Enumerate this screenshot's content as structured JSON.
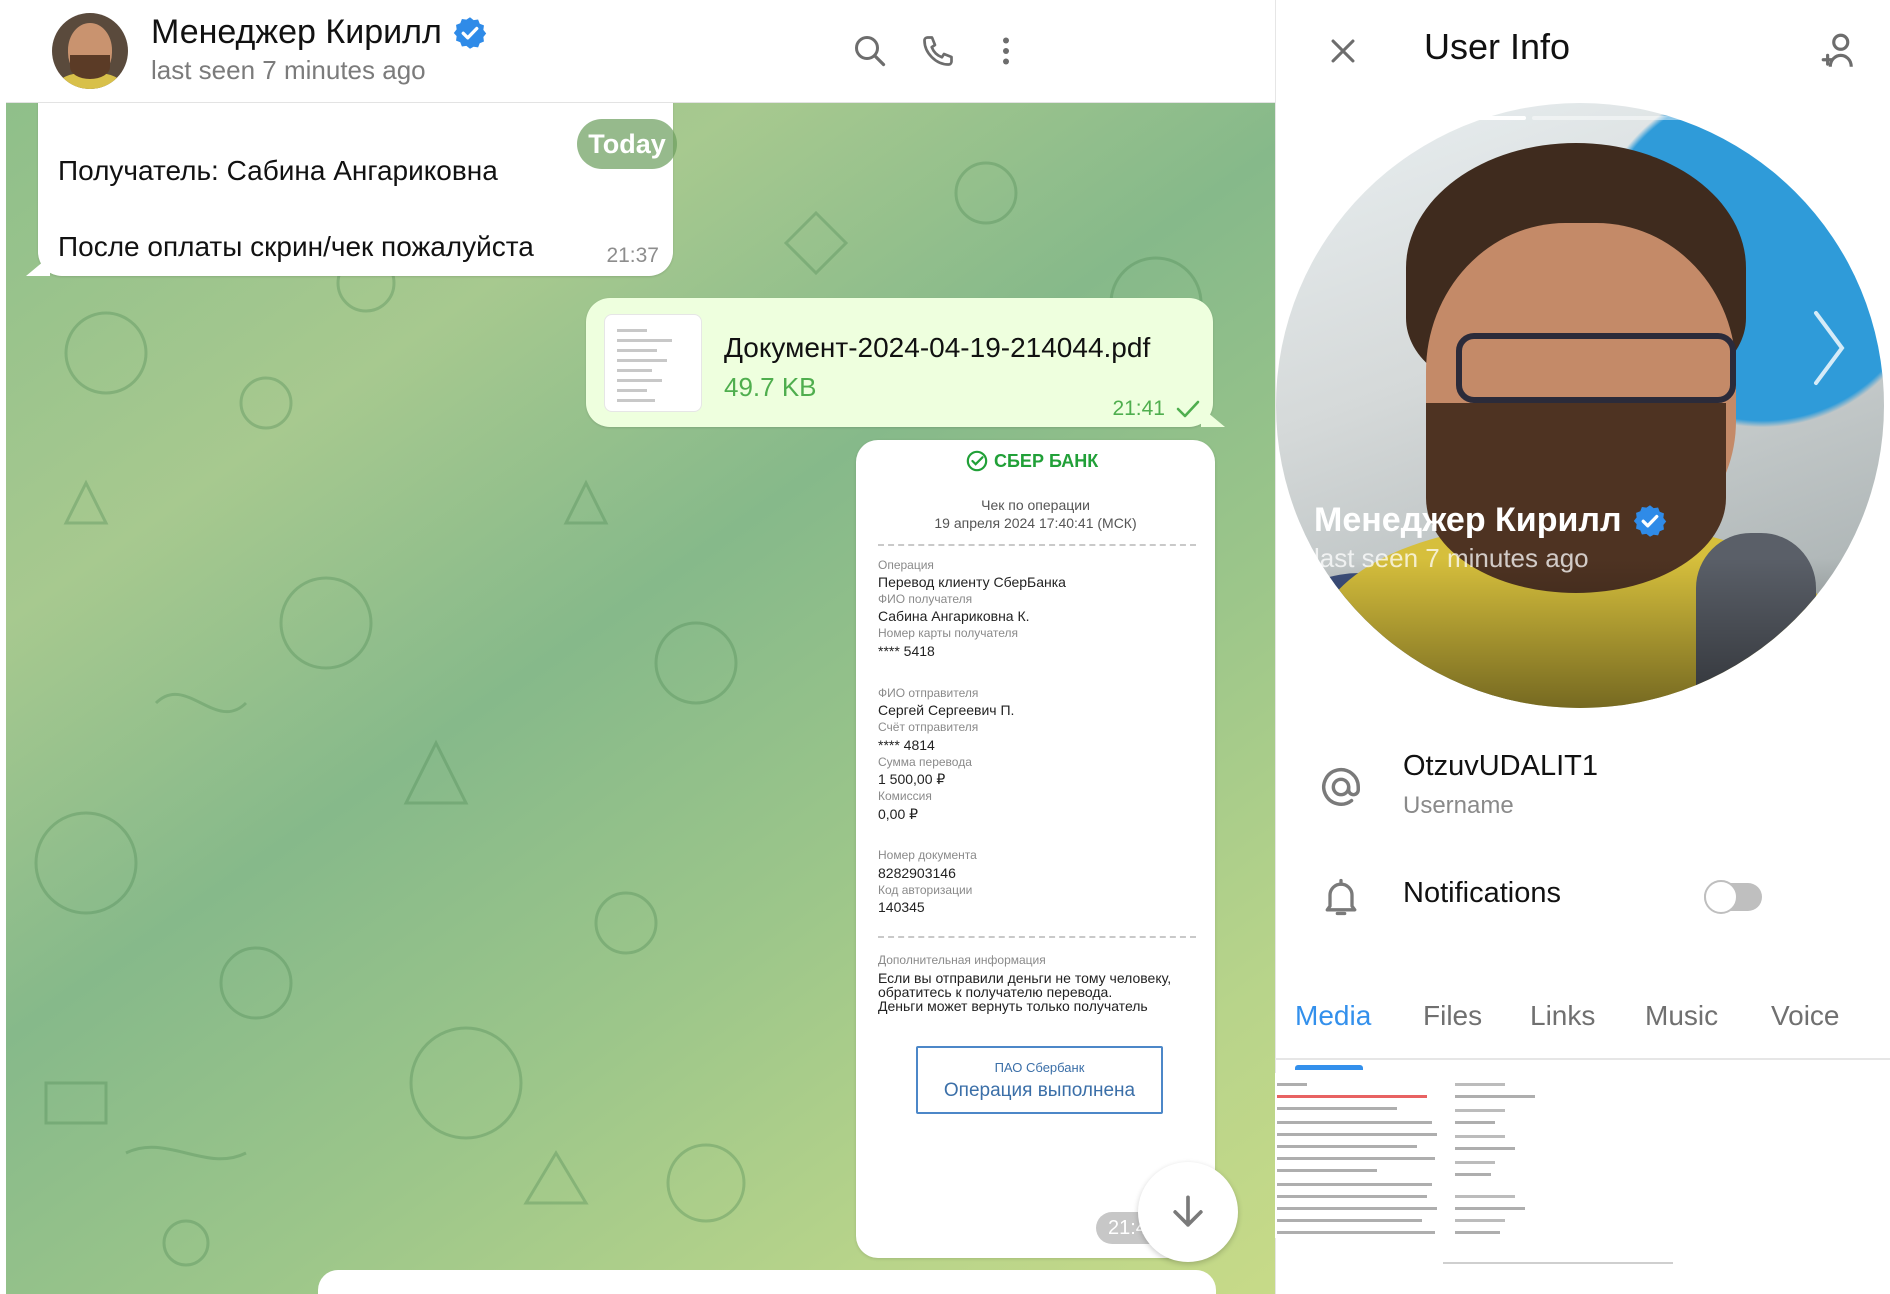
{
  "chat": {
    "name": "Менеджер Кирилл",
    "status": "last seen 7 minutes ago",
    "icons": [
      "search-icon",
      "phone-icon",
      "more-vertical-icon"
    ],
    "date_badge": "Today",
    "messages": [
      {
        "lines": [
          "Получатель: Сабина Ангариковна",
          "После оплаты скрин/чек пожалуйста"
        ],
        "time": "21:37"
      },
      {
        "file_name": "Документ-2024-04-19-214044.pdf",
        "file_size": "49.7 KB",
        "time": "21:41",
        "status_icon": "check-icon"
      }
    ],
    "receipt": {
      "bank": "СБЕР БАНК",
      "title": "Чек по операции",
      "datetime": "19 апреля 2024 17:40:41 (МСК)",
      "fields": [
        {
          "label": "Операция",
          "value": "Перевод клиенту СберБанка"
        },
        {
          "label": "ФИО получателя",
          "value": "Сабина Ангариковна К."
        },
        {
          "label": "Номер карты получателя",
          "value": "**** 5418"
        },
        {
          "label": "ФИО отправителя",
          "value": "Сергей Сергеевич П."
        },
        {
          "label": "Счёт отправителя",
          "value": "**** 4814"
        },
        {
          "label": "Сумма перевода",
          "value": "1 500,00 ₽"
        },
        {
          "label": "Комиссия",
          "value": "0,00 ₽"
        },
        {
          "label": "Номер документа",
          "value": "8282903146"
        },
        {
          "label": "Код авторизации",
          "value": "140345"
        }
      ],
      "extra_label": "Дополнительная информация",
      "extra_lines": [
        "Если вы отправили деньги не тому человеку,",
        "обратитесь к получателю перевода.",
        "Деньги может вернуть только получатель"
      ],
      "stamp_small": "ПАО Сбербанк",
      "stamp_big": "Операция выполнена",
      "time": "21:4"
    }
  },
  "info": {
    "title": "User Info",
    "name": "Менеджер Кирилл",
    "status": "last seen 7 minutes ago",
    "username": "OtzuvUDALIT1",
    "username_label": "Username",
    "notifications_label": "Notifications",
    "notifications_on": false,
    "tabs": [
      "Media",
      "Files",
      "Links",
      "Music",
      "Voice"
    ],
    "active_tab": "Media"
  },
  "colors": {
    "accent": "#3390ec",
    "outgoing_bubble": "#eeffde",
    "outgoing_meta": "#4fae4e",
    "sber_green": "#21a038"
  }
}
